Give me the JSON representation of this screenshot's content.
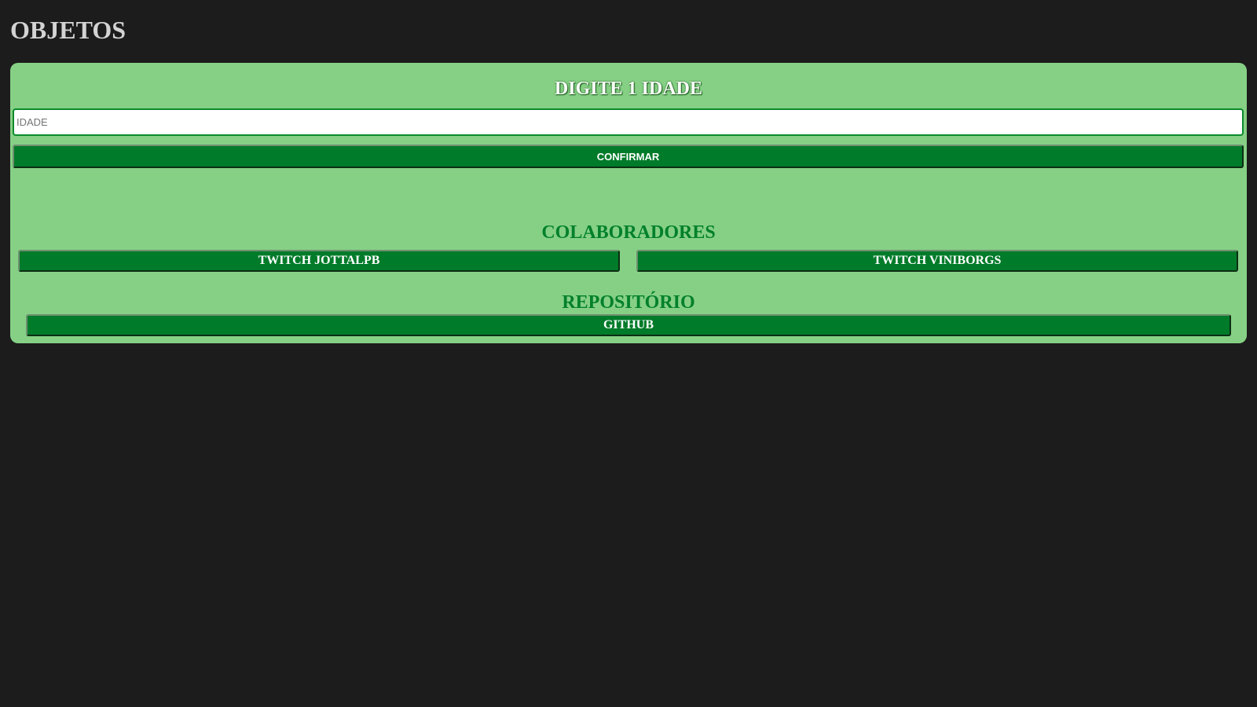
{
  "page": {
    "title": "OBJETOS"
  },
  "form": {
    "title": "DIGITE 1 IDADE",
    "age_input": {
      "value": "",
      "placeholder": "IDADE"
    },
    "confirm_label": "CONFIRMAR"
  },
  "collaborators": {
    "title": "COLABORADORES",
    "links": [
      {
        "label": "TWITCH JOTTALPB"
      },
      {
        "label": "TWITCH VINIBORGS"
      }
    ]
  },
  "repository": {
    "title": "REPOSITÓRIO",
    "link_label": "GITHUB"
  },
  "colors": {
    "page_background": "#1c1c1c",
    "panel_background": "#86d086",
    "accent_green": "#007b2a",
    "title_grey": "#d3d3d3"
  }
}
